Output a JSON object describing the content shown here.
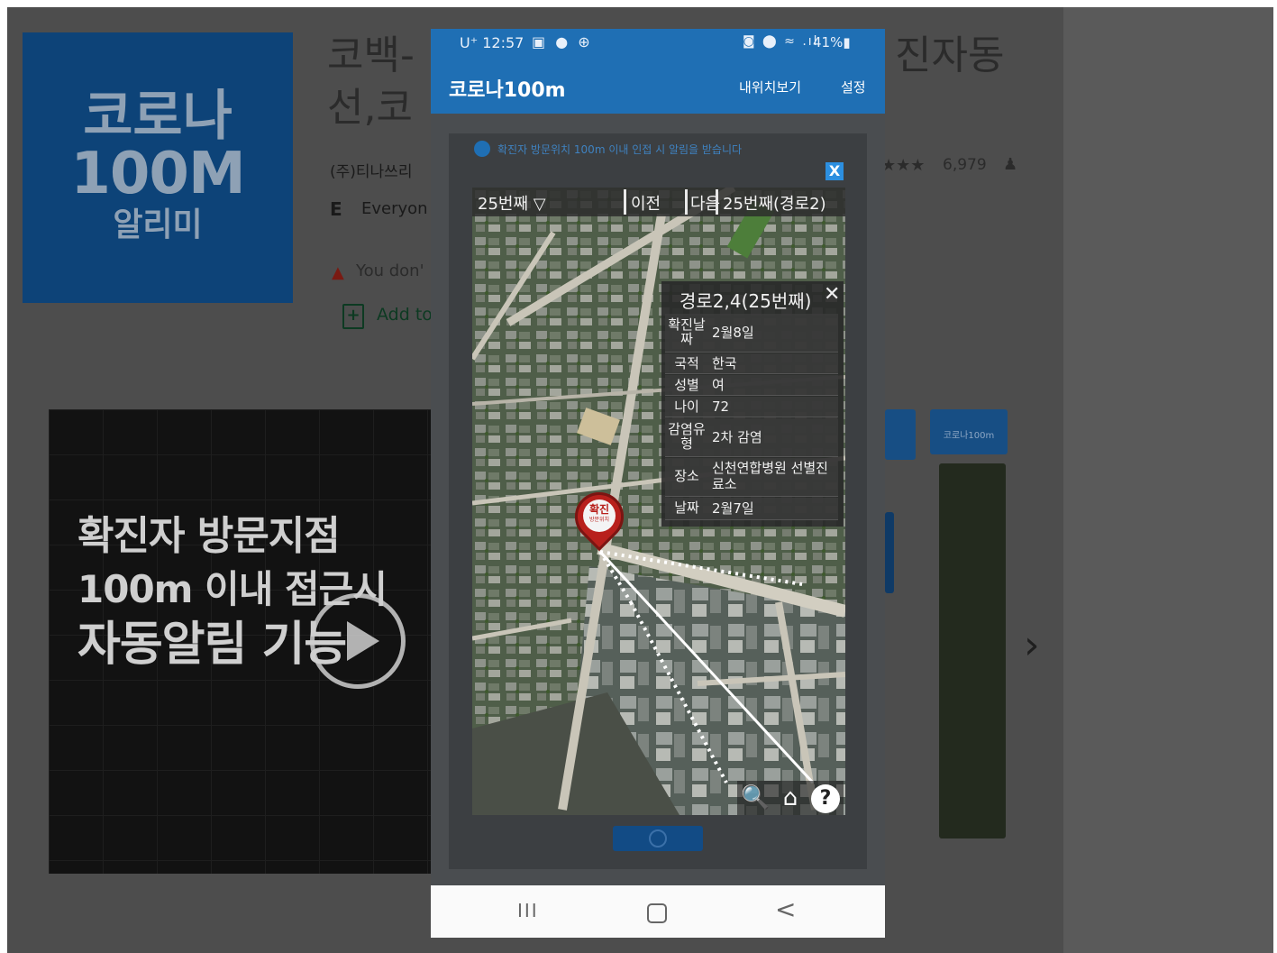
{
  "store": {
    "logo": {
      "line1": "코로나",
      "line2": "100M",
      "line3": "알리미"
    },
    "title_part1": "코백-",
    "title_part2": "선,코",
    "title_right": "진자동",
    "developer": "(주)티나쓰리",
    "rating_label": "Everyon",
    "warning_text": "You don'",
    "wishlist_text": "Add to",
    "stars": "★★★",
    "review_count": "6,979",
    "promo": {
      "line1": "확진자 방문지점",
      "line2": "100m 이내 접근시",
      "line3": "자동알림 기능"
    },
    "thumb_text": "코로나100m"
  },
  "phone": {
    "status": {
      "carrier": "U⁺ 12:57",
      "left_icons": "▣ ● ⊕",
      "right_icons": "◙ ⬤ ≈ .ıl",
      "battery": "41%▮"
    },
    "app_title": "코로나100m",
    "menu": {
      "my_location": "내위치보기",
      "settings": "설정"
    },
    "alert_text": "확진자 방문위치 100m 이내 인접 시 알림을 받습니다",
    "close_label": "X",
    "nav": {
      "select": "25번째 ▽",
      "prev": "이전",
      "next": "다음",
      "current": "25번째(경로2)"
    },
    "popup": {
      "title": "경로2,4(25번째)",
      "close": "✕",
      "rows": [
        {
          "key": "확진날짜",
          "value": "2월8일"
        },
        {
          "key": "국적",
          "value": "한국"
        },
        {
          "key": "성별",
          "value": "여"
        },
        {
          "key": "나이",
          "value": "72"
        },
        {
          "key": "감염유형",
          "value": "2차 감염"
        },
        {
          "key": "장소",
          "value": "신천연합병원 선별진료소"
        },
        {
          "key": "날짜",
          "value": "2월7일"
        }
      ]
    },
    "marker": {
      "label": "확진",
      "sub": "방문위치"
    },
    "tools": {
      "search": "🔍",
      "home": "⌂",
      "help": "?"
    },
    "sysnav": {
      "recents": "III",
      "back": "<"
    }
  }
}
